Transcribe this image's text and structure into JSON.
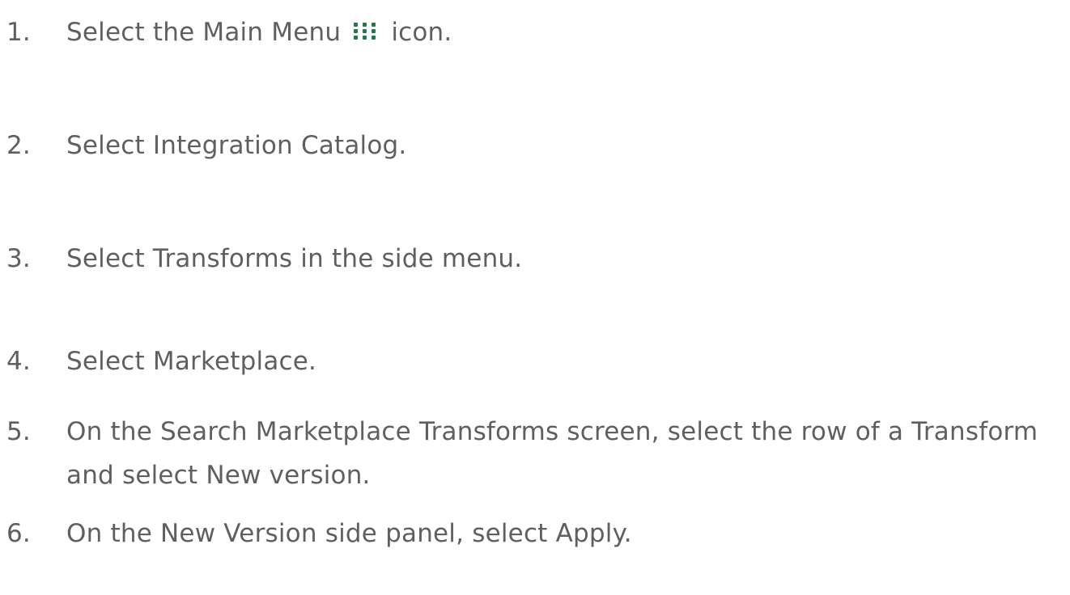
{
  "steps": [
    {
      "number": "1.",
      "before": "Select the Main Menu",
      "icon": "grid-dots-icon",
      "after": "icon."
    },
    {
      "number": "2.",
      "text": "Select Integration Catalog."
    },
    {
      "number": "3.",
      "text": "Select Transforms in the side menu."
    },
    {
      "number": "4.",
      "text": "Select Marketplace."
    },
    {
      "number": "5.",
      "line1": "On the Search Marketplace Transforms screen, select the row of a Transform",
      "line2": "and select New version."
    },
    {
      "number": "6.",
      "text": "On the New Version side panel, select Apply."
    }
  ],
  "colors": {
    "text": "#5f5f5f",
    "icon": "#1f7a4d"
  }
}
